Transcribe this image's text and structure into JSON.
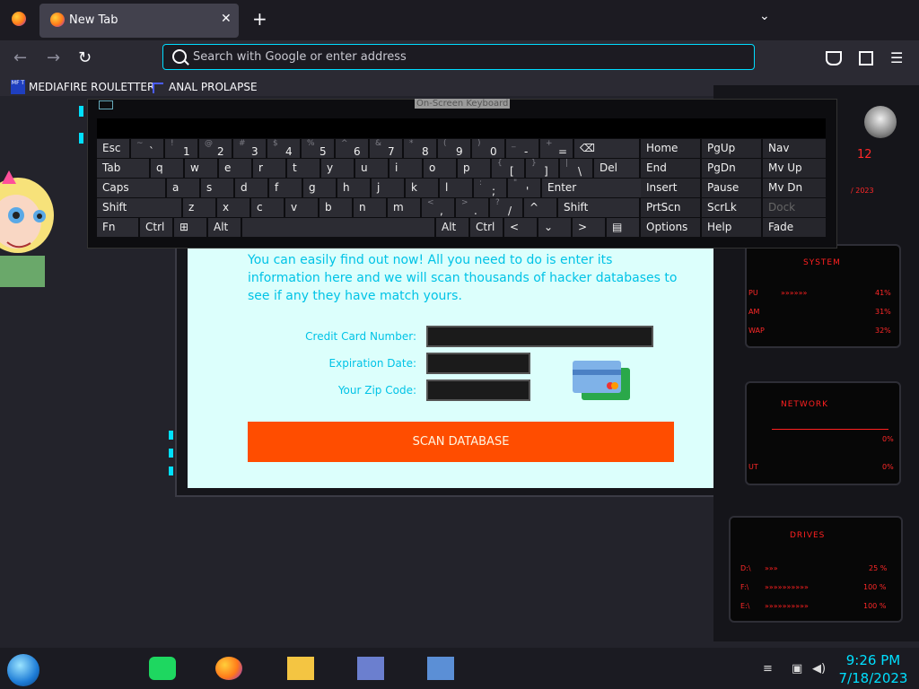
{
  "browser": {
    "tab_title": "New Tab",
    "tab_close": "✕",
    "new_tab": "+",
    "tab_list": "⌄",
    "url_placeholder": "Search with Google or enter address",
    "back": "←",
    "forward": "→",
    "reload": "↻",
    "pocket_icon": "pocket-icon",
    "extensions_icon": "extensions-icon",
    "menu_icon": "☰",
    "bookmarks": [
      {
        "label": "MEDIAFIRE ROULETTER",
        "icon_text": "MF T"
      },
      {
        "label": "ANAL PROLAPSE"
      }
    ]
  },
  "osk": {
    "title": "On-Screen Keyboard",
    "rows": [
      [
        {
          "m": "Esc"
        },
        {
          "s": "~",
          "m": "`"
        },
        {
          "s": "!",
          "m": "1"
        },
        {
          "s": "@",
          "m": "2"
        },
        {
          "s": "#",
          "m": "3"
        },
        {
          "s": "$",
          "m": "4"
        },
        {
          "s": "%",
          "m": "5"
        },
        {
          "s": "^",
          "m": "6"
        },
        {
          "s": "&",
          "m": "7"
        },
        {
          "s": "*",
          "m": "8"
        },
        {
          "s": "(",
          "m": "9"
        },
        {
          "s": ")",
          "m": "0"
        },
        {
          "s": "_",
          "m": "-"
        },
        {
          "s": "+",
          "m": "="
        },
        {
          "m": "⌫"
        }
      ],
      [
        {
          "m": "Tab"
        },
        {
          "m": "q"
        },
        {
          "m": "w"
        },
        {
          "m": "e"
        },
        {
          "m": "r"
        },
        {
          "m": "t"
        },
        {
          "m": "y"
        },
        {
          "m": "u"
        },
        {
          "m": "i"
        },
        {
          "m": "o"
        },
        {
          "m": "p"
        },
        {
          "s": "{",
          "m": "["
        },
        {
          "s": "}",
          "m": "]"
        },
        {
          "s": "|",
          "m": "\\"
        },
        {
          "m": "Del"
        }
      ],
      [
        {
          "m": "Caps"
        },
        {
          "m": "a"
        },
        {
          "m": "s"
        },
        {
          "m": "d"
        },
        {
          "m": "f"
        },
        {
          "m": "g"
        },
        {
          "m": "h"
        },
        {
          "m": "j"
        },
        {
          "m": "k"
        },
        {
          "m": "l"
        },
        {
          "s": ":",
          "m": ";"
        },
        {
          "s": "\"",
          "m": "'"
        },
        {
          "m": "Enter"
        }
      ],
      [
        {
          "m": "Shift"
        },
        {
          "m": "z"
        },
        {
          "m": "x"
        },
        {
          "m": "c"
        },
        {
          "m": "v"
        },
        {
          "m": "b"
        },
        {
          "m": "n"
        },
        {
          "m": "m"
        },
        {
          "s": "<",
          "m": ","
        },
        {
          "s": ">",
          "m": "."
        },
        {
          "s": "?",
          "m": "/"
        },
        {
          "m": "^"
        },
        {
          "m": "Shift"
        }
      ],
      [
        {
          "m": "Fn"
        },
        {
          "m": "Ctrl"
        },
        {
          "m": "⊞"
        },
        {
          "m": "Alt"
        },
        {
          "m": ""
        },
        {
          "m": "Alt"
        },
        {
          "m": "Ctrl"
        },
        {
          "m": "<"
        },
        {
          "m": "⌄"
        },
        {
          "m": ">"
        },
        {
          "m": "▤"
        }
      ]
    ],
    "nav": [
      [
        "Home",
        "PgUp",
        "Nav"
      ],
      [
        "End",
        "PgDn",
        "Mv Up"
      ],
      [
        "Insert",
        "Pause",
        "Mv Dn"
      ],
      [
        "PrtScn",
        "ScrLk",
        "Dock"
      ],
      [
        "Options",
        "Help",
        "Fade"
      ]
    ]
  },
  "page": {
    "intro": "You can easily find out now! All you need to do is enter its information here and we will scan thousands of hacker databases to see if any they have match yours.",
    "card_label": "Credit Card Number:",
    "exp_label": "Expiration Date:",
    "zip_label": "Your Zip Code:",
    "scan_button": "SCAN DATABASE"
  },
  "widget": {
    "system_title": "SYSTEM",
    "system_rows": [
      {
        "label": "PU",
        "value": "41%"
      },
      {
        "label": "AM",
        "value": "31%"
      },
      {
        "label": "WAP",
        "value": "32%"
      }
    ],
    "network_title": "NETWORK",
    "network_rows": [
      {
        "label": "",
        "value": "0%"
      },
      {
        "label": "UT",
        "value": "0%"
      }
    ],
    "drives_title": "DRIVES",
    "drives_rows": [
      {
        "label": "D:\\",
        "value": "25 %"
      },
      {
        "label": "F:\\",
        "value": "100 %"
      },
      {
        "label": "E:\\",
        "value": "100 %"
      }
    ],
    "date_frag": "/ 2023",
    "num_frag": "12"
  },
  "taskbar": {
    "time": "9:26 PM",
    "date": "7/18/2023"
  },
  "colors": {
    "accent": "#00ddff",
    "scan": "#ff4d00",
    "widget_red": "#ff2020"
  }
}
